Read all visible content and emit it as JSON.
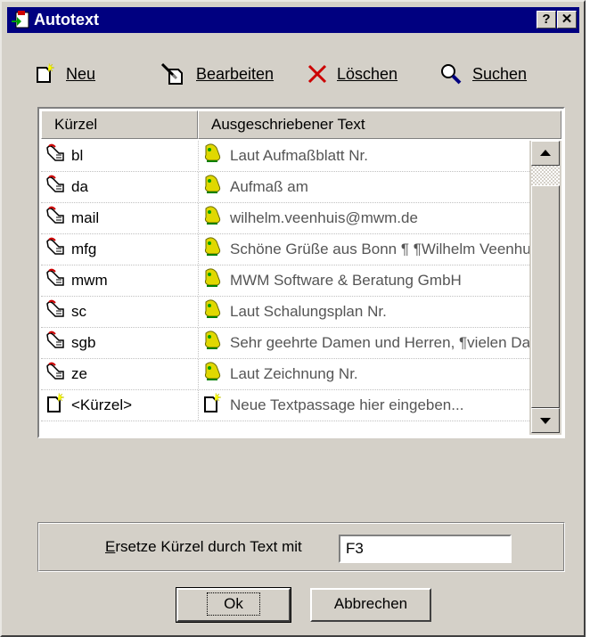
{
  "window": {
    "title": "Autotext",
    "help_btn": "?",
    "close_btn": "✕"
  },
  "toolbar": {
    "new_label": "Neu",
    "edit_label": "Bearbeiten",
    "delete_label": "Löschen",
    "search_label": "Suchen"
  },
  "list": {
    "columns": [
      "Kürzel",
      "Ausgeschriebener Text"
    ],
    "rows": [
      {
        "shortcut": "bl",
        "text": "Laut Aufmaßblatt Nr.",
        "icon": "hand-icon",
        "text_icon": "bell-icon"
      },
      {
        "shortcut": "da",
        "text": "Aufmaß am",
        "icon": "hand-icon",
        "text_icon": "bell-icon"
      },
      {
        "shortcut": "mail",
        "text": "wilhelm.veenhuis@mwm.de",
        "icon": "hand-icon",
        "text_icon": "bell-icon"
      },
      {
        "shortcut": "mfg",
        "text": "Schöne Grüße aus Bonn ¶ ¶Wilhelm Veenhuis",
        "icon": "hand-icon",
        "text_icon": "bell-icon"
      },
      {
        "shortcut": "mwm",
        "text": "MWM Software & Beratung GmbH",
        "icon": "hand-icon",
        "text_icon": "bell-icon"
      },
      {
        "shortcut": "sc",
        "text": "Laut Schalungsplan Nr.",
        "icon": "hand-icon",
        "text_icon": "bell-icon"
      },
      {
        "shortcut": "sgb",
        "text": "Sehr geehrte Damen und Herren, ¶vielen Dank",
        "icon": "hand-icon",
        "text_icon": "bell-icon"
      },
      {
        "shortcut": "ze",
        "text": "Laut Zeichnung Nr.",
        "icon": "hand-icon",
        "text_icon": "bell-icon"
      },
      {
        "shortcut": "<Kürzel>",
        "text": "Neue Textpassage hier eingeben...",
        "icon": "new-doc-icon",
        "text_icon": "new-doc-icon"
      }
    ]
  },
  "hotkey": {
    "label_prefix": "E",
    "label_rest": "rsetze Kürzel durch Text mit",
    "value": "F3"
  },
  "buttons": {
    "ok": "Ok",
    "cancel": "Abbrechen"
  },
  "colors": {
    "titlebar": "#000080",
    "face": "#d4d0c8",
    "delete_icon": "#cc0000",
    "bell_icon": "#d4c800"
  }
}
